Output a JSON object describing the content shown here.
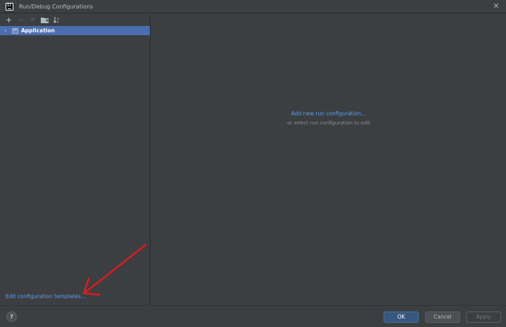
{
  "window": {
    "title": "Run/Debug Configurations",
    "app_logo_text": "IJ",
    "close_symbol": "✕"
  },
  "toolbar": {
    "buttons": [
      {
        "icon": "plus-icon",
        "symbol": "+",
        "enabled": true
      },
      {
        "icon": "minus-icon",
        "symbol": "−",
        "enabled": false
      },
      {
        "icon": "copy-icon",
        "symbol": "⧉",
        "enabled": false
      },
      {
        "icon": "folder-icon",
        "symbol": "▇",
        "enabled": true
      },
      {
        "icon": "sort-icon",
        "symbol": "⇅",
        "enabled": true
      }
    ]
  },
  "tree": {
    "items": [
      {
        "label": "Application",
        "expanded": false,
        "selected": true
      }
    ]
  },
  "left_footer": {
    "templates_link": "Edit configuration templates..."
  },
  "main": {
    "add_link": "Add new run configuration...",
    "hint": "or select run configuration to edit"
  },
  "footer": {
    "help_label": "?",
    "ok_label": "OK",
    "cancel_label": "Cancel",
    "apply_label": "Apply"
  },
  "colors": {
    "background": "#3c3f41",
    "selection": "#4b6eaf",
    "link": "#589df6",
    "primary_button": "#365880",
    "annotation_arrow": "#e0191b"
  }
}
